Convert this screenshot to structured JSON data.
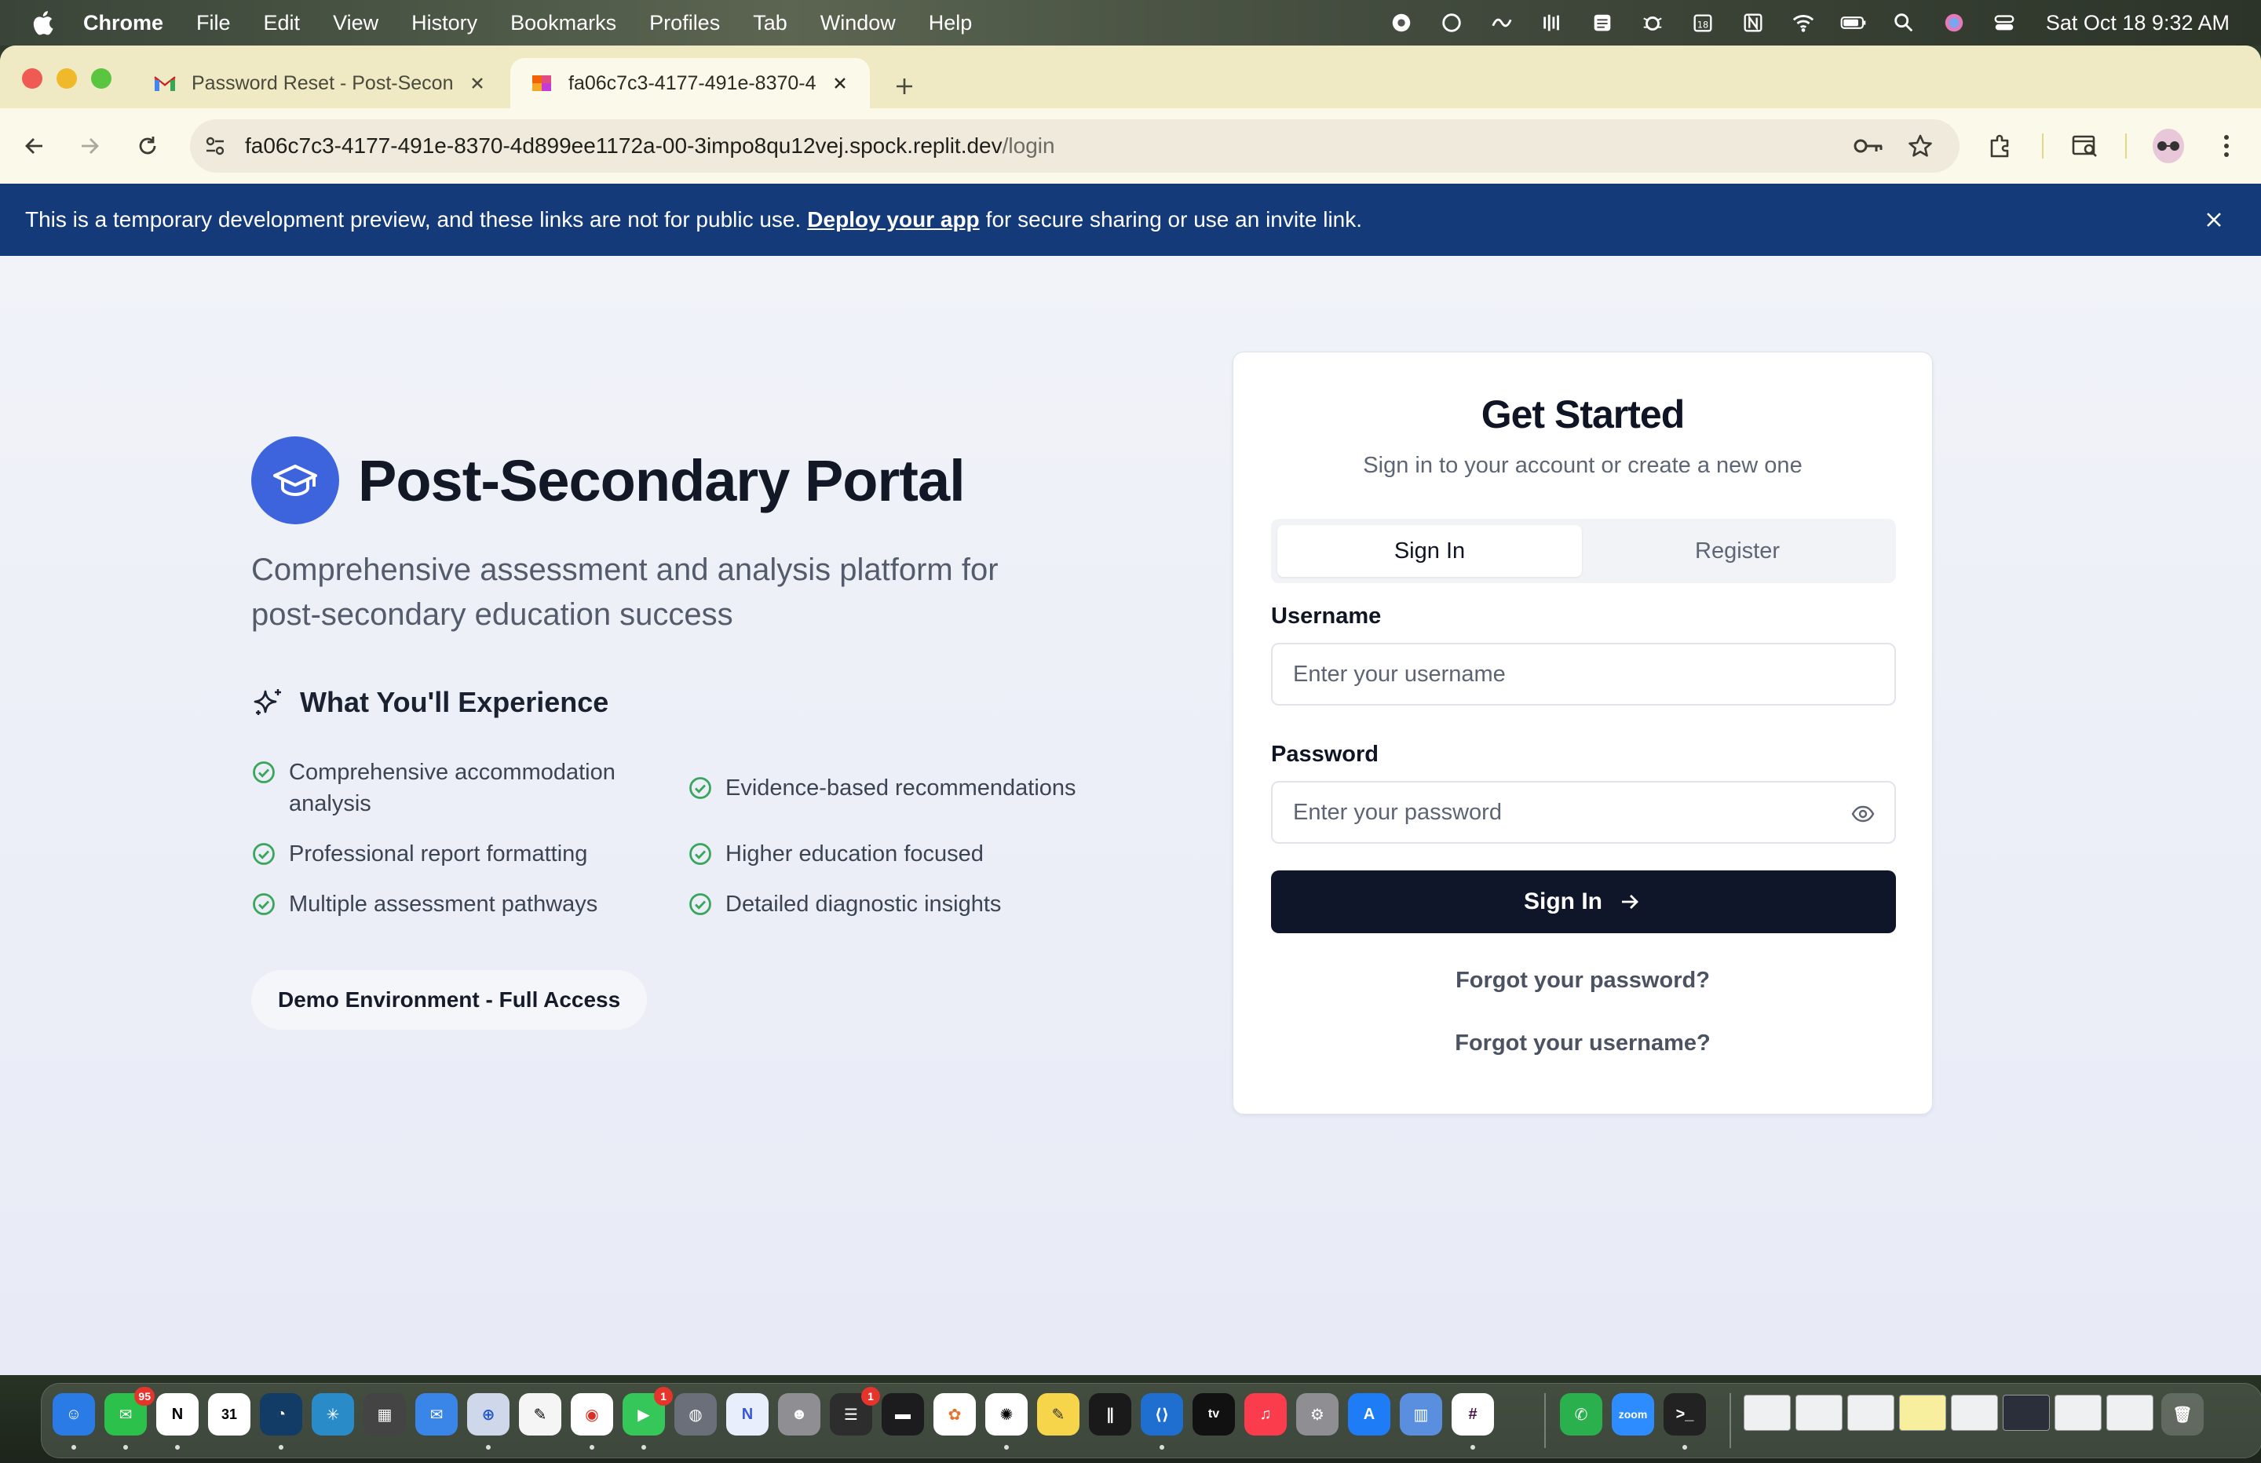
{
  "menubar": {
    "app_name": "Chrome",
    "menus": [
      "File",
      "Edit",
      "View",
      "History",
      "Bookmarks",
      "Profiles",
      "Tab",
      "Window",
      "Help"
    ],
    "clock": "Sat Oct 18  9:32 AM"
  },
  "browser": {
    "tabs": [
      {
        "title": "Password Reset - Post-Secon",
        "favicon": "gmail-icon",
        "active": false
      },
      {
        "title": "fa06c7c3-4177-491e-8370-4",
        "favicon": "replit-icon",
        "active": true
      }
    ],
    "url_host": "fa06c7c3-4177-491e-8370-4d899ee1172a-00-3impo8qu12vej.spock.replit.dev",
    "url_path": "/login"
  },
  "banner": {
    "text_before": "This is a temporary development preview, and these links are not for public use.",
    "link": "Deploy your app",
    "text_after": "for secure sharing or use an invite link."
  },
  "hero": {
    "title": "Post-Secondary Portal",
    "tagline": "Comprehensive assessment and analysis platform for post-secondary education success",
    "experience_title": "What You'll Experience",
    "features": [
      "Comprehensive accommodation analysis",
      "Evidence-based recommendations",
      "Professional report formatting",
      "Higher education focused",
      "Multiple assessment pathways",
      "Detailed diagnostic insights"
    ],
    "demo_label": "Demo Environment - Full Access"
  },
  "auth": {
    "title": "Get Started",
    "subtitle": "Sign in to your account or create a new one",
    "tabs": [
      "Sign In",
      "Register"
    ],
    "username_label": "Username",
    "username_placeholder": "Enter your username",
    "password_label": "Password",
    "password_placeholder": "Enter your password",
    "submit_label": "Sign In",
    "forgot_password": "Forgot your password?",
    "forgot_username": "Forgot your username?"
  },
  "dock": {
    "messages_badge": "95",
    "facetime_badge": "1",
    "reminders_badge": "1",
    "zoom_label": "zoom"
  },
  "colors": {
    "banner_bg": "#143a7a",
    "brand_blue": "#3d63dd",
    "button_dark": "#0f1629",
    "check_green": "#3aa55d",
    "tabstrip_bg": "#efeac4"
  }
}
